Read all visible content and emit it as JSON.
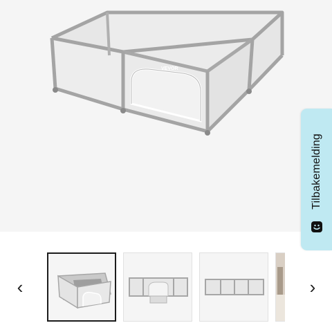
{
  "product_image": {
    "alt": "Playpen main image",
    "brand_mark": "VEVOR"
  },
  "feedback": {
    "label": "Tilbakemelding",
    "icon": "smiley-chat-icon"
  },
  "gallery": {
    "prev_icon": "chevron-left-icon",
    "next_icon": "chevron-right-icon",
    "prev_glyph": "‹",
    "next_glyph": "›",
    "thumbnails": [
      {
        "view": "top-angle",
        "selected": true
      },
      {
        "view": "front-open-door",
        "selected": false
      },
      {
        "view": "front-closed",
        "selected": false
      },
      {
        "view": "room-scene-partial",
        "selected": false
      }
    ]
  }
}
